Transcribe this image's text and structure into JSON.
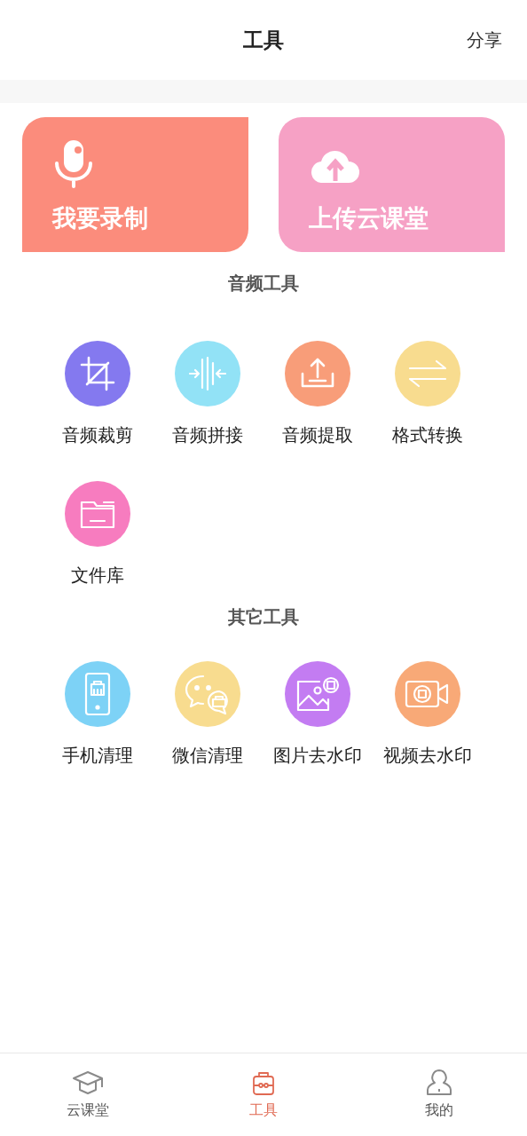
{
  "header": {
    "title": "工具",
    "action": "分享"
  },
  "cards": [
    {
      "label": "我要录制",
      "color": "#fb8c7c"
    },
    {
      "label": "上传云课堂",
      "color": "#f6a1c5"
    }
  ],
  "sections": [
    {
      "title": "音频工具",
      "tools": [
        {
          "label": "音频裁剪",
          "color": "#8479ef"
        },
        {
          "label": "音频拼接",
          "color": "#92e2f6"
        },
        {
          "label": "音频提取",
          "color": "#f89d79"
        },
        {
          "label": "格式转换",
          "color": "#f8dc8f"
        },
        {
          "label": "文件库",
          "color": "#f77cbf"
        }
      ]
    },
    {
      "title": "其它工具",
      "tools": [
        {
          "label": "手机清理",
          "color": "#7dd2f6"
        },
        {
          "label": "微信清理",
          "color": "#f8dc8f"
        },
        {
          "label": "图片去水印",
          "color": "#c37cf2"
        },
        {
          "label": "视频去水印",
          "color": "#f8a977"
        }
      ]
    }
  ],
  "tabbar": [
    {
      "label": "云课堂",
      "selected": false
    },
    {
      "label": "工具",
      "selected": true
    },
    {
      "label": "我的",
      "selected": false
    }
  ]
}
